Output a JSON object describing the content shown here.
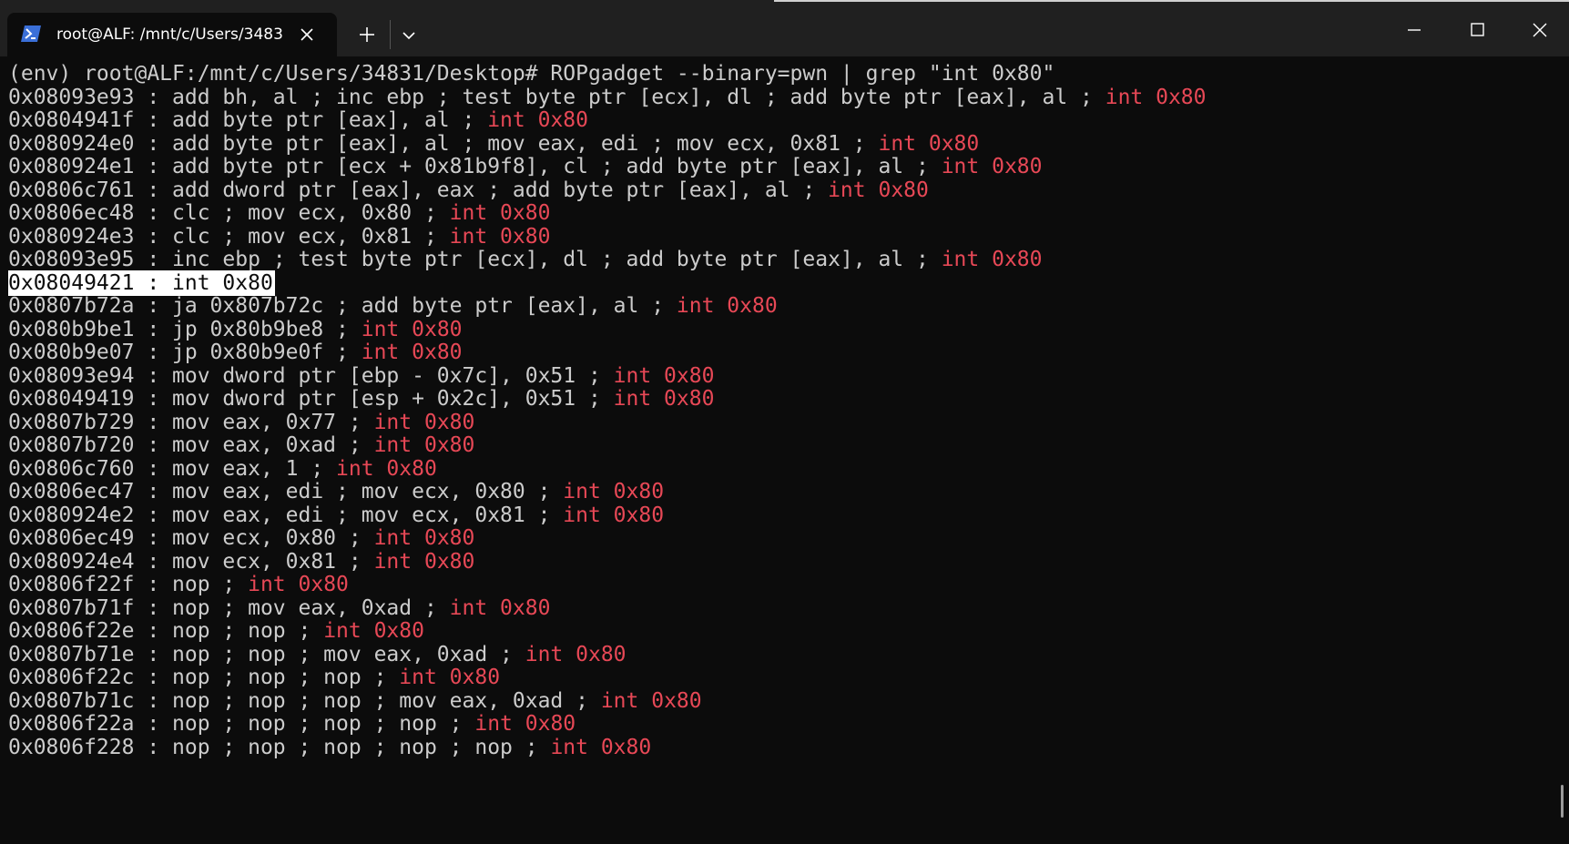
{
  "tab": {
    "title": "root@ALF: /mnt/c/Users/3483"
  },
  "colors": {
    "window_background": "#0c0c0c",
    "titlebar_background": "#202020",
    "text": "#cccccc",
    "highlight": "#e74856",
    "selection_background": "#ffffff"
  },
  "icons": {
    "tab_icon": "powershell-icon",
    "tab_close": "close-icon",
    "new_tab": "plus-icon",
    "dropdown": "chevron-down-icon",
    "minimize": "minimize-icon",
    "maximize": "maximize-icon",
    "close": "close-icon"
  },
  "terminal": {
    "lines": [
      {
        "text": "(env) root@ALF:/mnt/c/Users/34831/Desktop# ROPgadget --binary=pwn | grep \"int 0x80\"",
        "hl": ""
      },
      {
        "text": "0x08093e93 : add bh, al ; inc ebp ; test byte ptr [ecx], dl ; add byte ptr [eax], al ; ",
        "hl": "int 0x80"
      },
      {
        "text": "0x0804941f : add byte ptr [eax], al ; ",
        "hl": "int 0x80"
      },
      {
        "text": "0x080924e0 : add byte ptr [eax], al ; mov eax, edi ; mov ecx, 0x81 ; ",
        "hl": "int 0x80"
      },
      {
        "text": "0x080924e1 : add byte ptr [ecx + 0x81b9f8], cl ; add byte ptr [eax], al ; ",
        "hl": "int 0x80"
      },
      {
        "text": "0x0806c761 : add dword ptr [eax], eax ; add byte ptr [eax], al ; ",
        "hl": "int 0x80"
      },
      {
        "text": "0x0806ec48 : clc ; mov ecx, 0x80 ; ",
        "hl": "int 0x80"
      },
      {
        "text": "0x080924e3 : clc ; mov ecx, 0x81 ; ",
        "hl": "int 0x80"
      },
      {
        "text": "0x08093e95 : inc ebp ; test byte ptr [ecx], dl ; add byte ptr [eax], al ; ",
        "hl": "int 0x80"
      },
      {
        "text": "0x08049421 : int 0x80",
        "hl": "",
        "selected": true
      },
      {
        "text": "0x0807b72a : ja 0x807b72c ; add byte ptr [eax], al ; ",
        "hl": "int 0x80"
      },
      {
        "text": "0x080b9be1 : jp 0x80b9be8 ; ",
        "hl": "int 0x80"
      },
      {
        "text": "0x080b9e07 : jp 0x80b9e0f ; ",
        "hl": "int 0x80"
      },
      {
        "text": "0x08093e94 : mov dword ptr [ebp - 0x7c], 0x51 ; ",
        "hl": "int 0x80"
      },
      {
        "text": "0x08049419 : mov dword ptr [esp + 0x2c], 0x51 ; ",
        "hl": "int 0x80"
      },
      {
        "text": "0x0807b729 : mov eax, 0x77 ; ",
        "hl": "int 0x80"
      },
      {
        "text": "0x0807b720 : mov eax, 0xad ; ",
        "hl": "int 0x80"
      },
      {
        "text": "0x0806c760 : mov eax, 1 ; ",
        "hl": "int 0x80"
      },
      {
        "text": "0x0806ec47 : mov eax, edi ; mov ecx, 0x80 ; ",
        "hl": "int 0x80"
      },
      {
        "text": "0x080924e2 : mov eax, edi ; mov ecx, 0x81 ; ",
        "hl": "int 0x80"
      },
      {
        "text": "0x0806ec49 : mov ecx, 0x80 ; ",
        "hl": "int 0x80"
      },
      {
        "text": "0x080924e4 : mov ecx, 0x81 ; ",
        "hl": "int 0x80"
      },
      {
        "text": "0x0806f22f : nop ; ",
        "hl": "int 0x80"
      },
      {
        "text": "0x0807b71f : nop ; mov eax, 0xad ; ",
        "hl": "int 0x80"
      },
      {
        "text": "0x0806f22e : nop ; nop ; ",
        "hl": "int 0x80"
      },
      {
        "text": "0x0807b71e : nop ; nop ; mov eax, 0xad ; ",
        "hl": "int 0x80"
      },
      {
        "text": "0x0806f22c : nop ; nop ; nop ; ",
        "hl": "int 0x80"
      },
      {
        "text": "0x0807b71c : nop ; nop ; nop ; mov eax, 0xad ; ",
        "hl": "int 0x80"
      },
      {
        "text": "0x0806f22a : nop ; nop ; nop ; nop ; ",
        "hl": "int 0x80"
      },
      {
        "text": "0x0806f228 : nop ; nop ; nop ; nop ; nop ; ",
        "hl": "int 0x80"
      }
    ]
  }
}
